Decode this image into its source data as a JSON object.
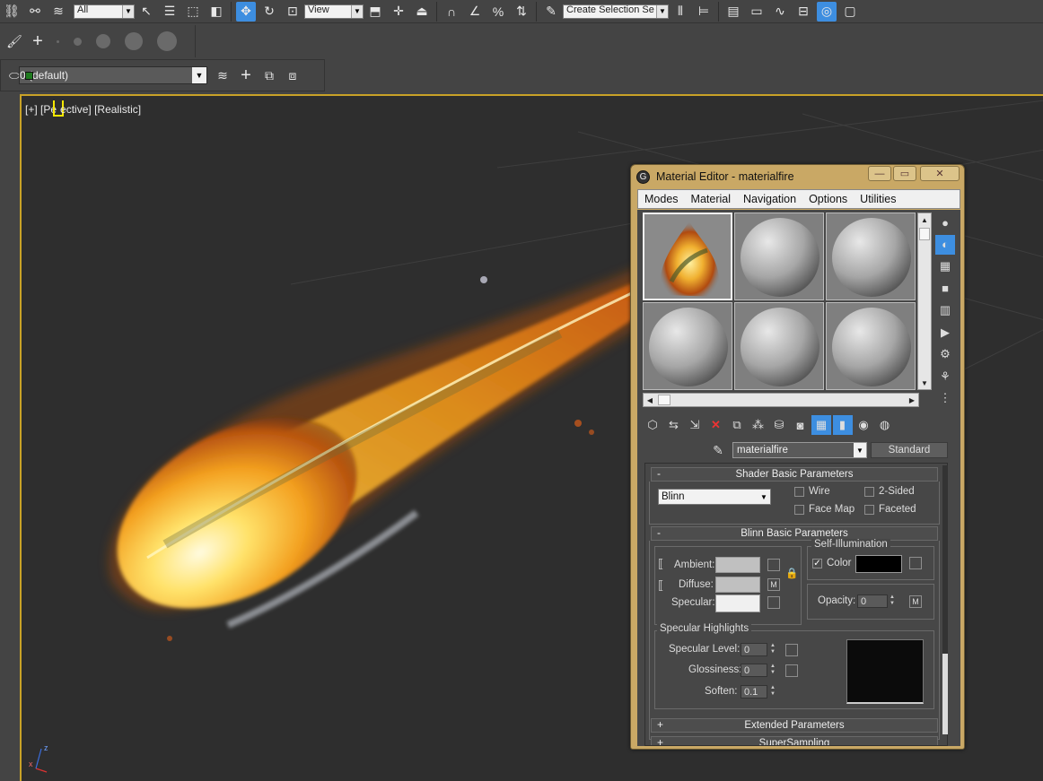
{
  "main_toolbar": {
    "selection_filter": "All",
    "reference_coord": "View",
    "named_selection_placeholder": "Create Selection Se"
  },
  "layer_bar": {
    "current_layer": "0 (default)"
  },
  "viewport": {
    "label_plus": "[+]",
    "label_view_before": "[Pe",
    "label_view_after": "ective]",
    "label_shading": "[Realistic]",
    "axis_x": "x",
    "axis_z": "z"
  },
  "material_editor": {
    "title": "Material Editor - materialfire",
    "menus": [
      "Modes",
      "Material",
      "Navigation",
      "Options",
      "Utilities"
    ],
    "material_name": "materialfire",
    "material_type": "Standard",
    "shader_rollout": {
      "title": "Shader Basic Parameters",
      "collapse_sign": "-",
      "shader": "Blinn",
      "options": [
        {
          "label": "Wire",
          "checked": false
        },
        {
          "label": "2-Sided",
          "checked": false
        },
        {
          "label": "Face Map",
          "checked": false
        },
        {
          "label": "Faceted",
          "checked": false
        }
      ]
    },
    "blinn_rollout": {
      "title": "Blinn Basic Parameters",
      "collapse_sign": "-",
      "ambient_label": "Ambient:",
      "diffuse_label": "Diffuse:",
      "specular_label": "Specular:",
      "ambient_color": "#c0c0c0",
      "diffuse_color": "#c0c0c0",
      "specular_color": "#f0f0f0",
      "map_button": "M",
      "self_illum_title": "Self-Illumination",
      "self_illum_color_label": "Color",
      "self_illum_color_checked": true,
      "self_illum_color": "#000000",
      "opacity_label": "Opacity:",
      "opacity_value": "0",
      "spec_highlights_title": "Specular Highlights",
      "specular_level_label": "Specular Level:",
      "specular_level": "0",
      "glossiness_label": "Glossiness:",
      "glossiness": "0",
      "soften_label": "Soften:",
      "soften": "0.1"
    },
    "collapsed_rollouts": [
      {
        "sign": "+",
        "title": "Extended Parameters"
      },
      {
        "sign": "+",
        "title": "SuperSampling"
      }
    ]
  }
}
